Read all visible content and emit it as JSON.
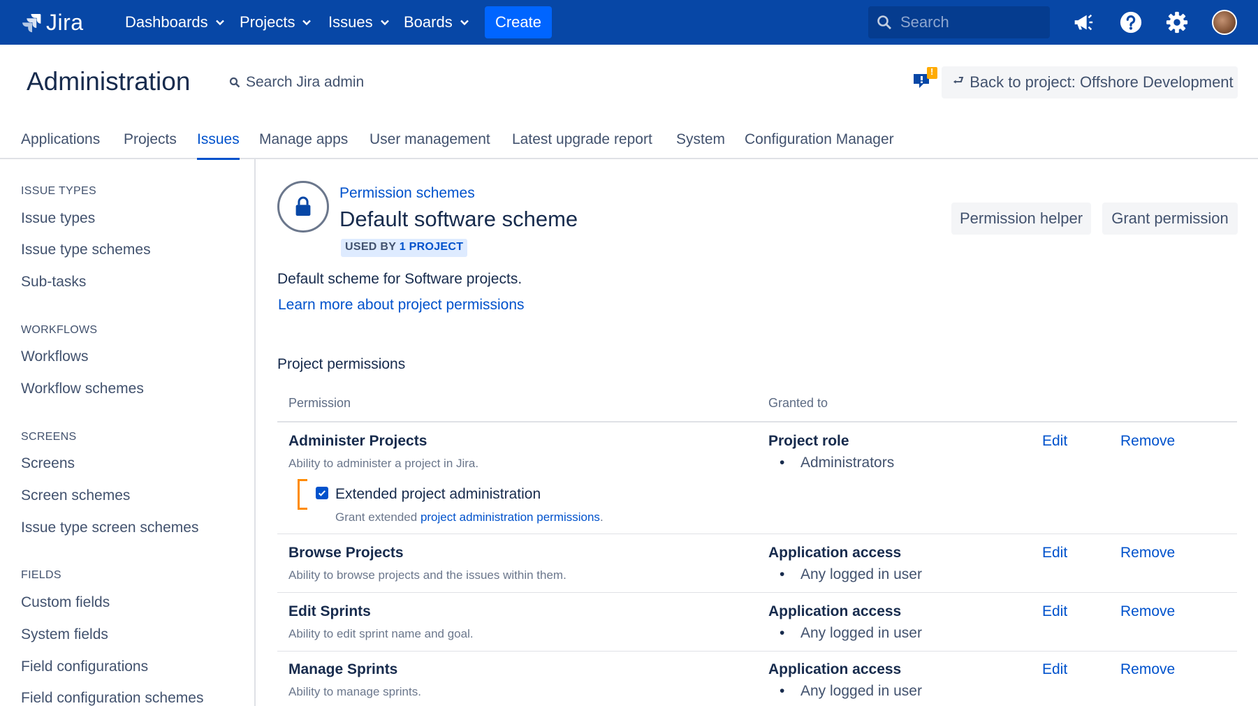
{
  "topnav": {
    "logo_text": "Jira",
    "menu": [
      "Dashboards",
      "Projects",
      "Issues",
      "Boards"
    ],
    "create_label": "Create",
    "search_placeholder": "Search"
  },
  "admin": {
    "title": "Administration",
    "search_label": "Search Jira admin",
    "feedback_badge": "!",
    "back_label": "Back to project: Offshore Development",
    "tabs": [
      "Applications",
      "Projects",
      "Issues",
      "Manage apps",
      "User management",
      "Latest upgrade report",
      "System",
      "Configuration Manager"
    ],
    "active_tab": "Issues"
  },
  "sidebar": {
    "sections": [
      {
        "heading": "ISSUE TYPES",
        "items": [
          "Issue types",
          "Issue type schemes",
          "Sub-tasks"
        ]
      },
      {
        "heading": "WORKFLOWS",
        "items": [
          "Workflows",
          "Workflow schemes"
        ]
      },
      {
        "heading": "SCREENS",
        "items": [
          "Screens",
          "Screen schemes",
          "Issue type screen schemes"
        ]
      },
      {
        "heading": "FIELDS",
        "items": [
          "Custom fields",
          "System fields",
          "Field configurations",
          "Field configuration schemes"
        ]
      }
    ]
  },
  "main": {
    "breadcrumb": "Permission schemes",
    "title": "Default software scheme",
    "badge_prefix": "USED BY",
    "badge_count": "1 PROJECT",
    "permission_helper_label": "Permission helper",
    "grant_permission_label": "Grant permission",
    "description": "Default scheme for Software projects.",
    "learn_more": "Learn more about project permissions",
    "section_title": "Project permissions",
    "columns": {
      "permission": "Permission",
      "granted_to": "Granted to"
    },
    "rows": [
      {
        "name": "Administer Projects",
        "desc": "Ability to administer a project in Jira.",
        "grant_type": "Project role",
        "grant_value": "Administrators",
        "edit": "Edit",
        "remove": "Remove"
      },
      {
        "name": "Browse Projects",
        "desc": "Ability to browse projects and the issues within them.",
        "grant_type": "Application access",
        "grant_value": "Any logged in user",
        "edit": "Edit",
        "remove": "Remove"
      },
      {
        "name": "Edit Sprints",
        "desc": "Ability to edit sprint name and goal.",
        "grant_type": "Application access",
        "grant_value": "Any logged in user",
        "edit": "Edit",
        "remove": "Remove"
      },
      {
        "name": "Manage Sprints",
        "desc": "Ability to manage sprints.",
        "grant_type": "Application access",
        "grant_value": "Any logged in user",
        "edit": "Edit",
        "remove": "Remove"
      }
    ],
    "extended": {
      "label": "Extended project administration",
      "checked": true,
      "sub_prefix": "Grant extended",
      "sub_link": "project administration permissions",
      "sub_suffix": "."
    }
  },
  "colors": {
    "nav": "#0747a6",
    "create": "#0065ff",
    "link": "#0052cc",
    "bracket": "#ff8b00"
  }
}
